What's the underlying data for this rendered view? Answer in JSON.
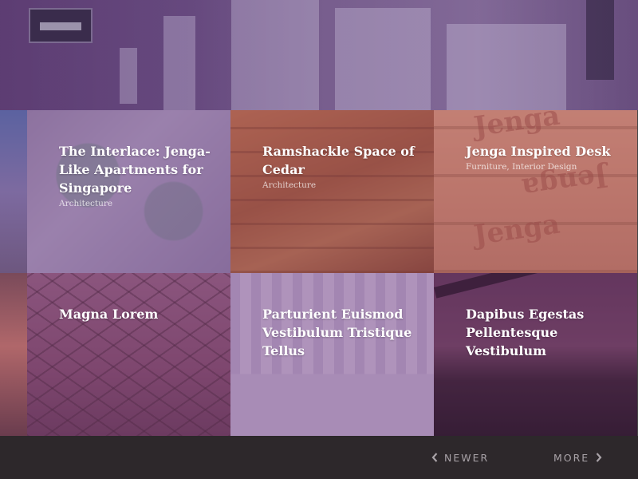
{
  "tiles": [
    {
      "title": "The Interlace: Jenga-Like Apartments for Singapore",
      "category": "Architecture"
    },
    {
      "title": "Ramshackle Space of Cedar",
      "category": "Architecture"
    },
    {
      "title": "Jenga Inspired Desk",
      "category": "Furniture, Interior Design"
    },
    {
      "title": "Magna Lorem",
      "category": ""
    },
    {
      "title": "Parturient Euismod Vestibulum Tristique Tellus",
      "category": ""
    },
    {
      "title": "Dapibus Egestas Pellentesque Vestibulum",
      "category": ""
    }
  ],
  "watermark": {
    "text": "Jenga"
  },
  "pagination": {
    "newer_label": "NEWER",
    "more_label": "MORE"
  },
  "icons": {
    "newer": "chevron-left-icon",
    "more": "chevron-right-icon"
  },
  "colors": {
    "overlay_purple": "#784896",
    "footer_bg": "#2d282b",
    "pager_text": "#a9a3a8"
  }
}
